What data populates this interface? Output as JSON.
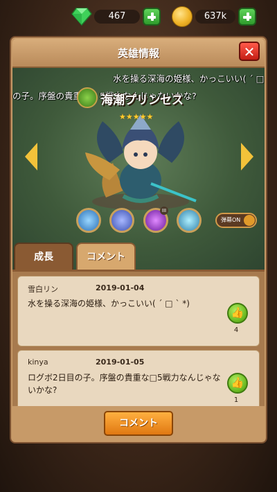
{
  "currency": {
    "gems": "467",
    "coins": "637k"
  },
  "window": {
    "title": "英雄情報"
  },
  "hero": {
    "name": "海潮プリンセス",
    "stars": 5
  },
  "danmaku": [
    "水を操る深海の姫様、かっこいい( ´ □",
    "の子。序盤の貴重な",
    "5戦力なんじゃないかな?"
  ],
  "toggle": {
    "label": "弾幕ON"
  },
  "skill_badge": "III",
  "tabs": {
    "growth": "成長",
    "comments": "コメント"
  },
  "comments": [
    {
      "user": "雪白リン",
      "date": "2019-01-04",
      "text": "水を操る深海の姫様、かっこいい( ´ □ ` *)",
      "likes": "4"
    },
    {
      "user": "kinya",
      "date": "2019-01-05",
      "text": "ログボ2日目の子。序盤の貴重な□5戦力なんじゃないかな?",
      "likes": "1"
    }
  ],
  "footer": {
    "comment_button": "コメント"
  },
  "icons": {
    "gem": "green-gem-icon",
    "coin": "gold-coin-icon",
    "plus": "plus-icon",
    "close": "close-x-icon",
    "element": "wind-element-icon",
    "like": "thumbs-up-icon"
  }
}
